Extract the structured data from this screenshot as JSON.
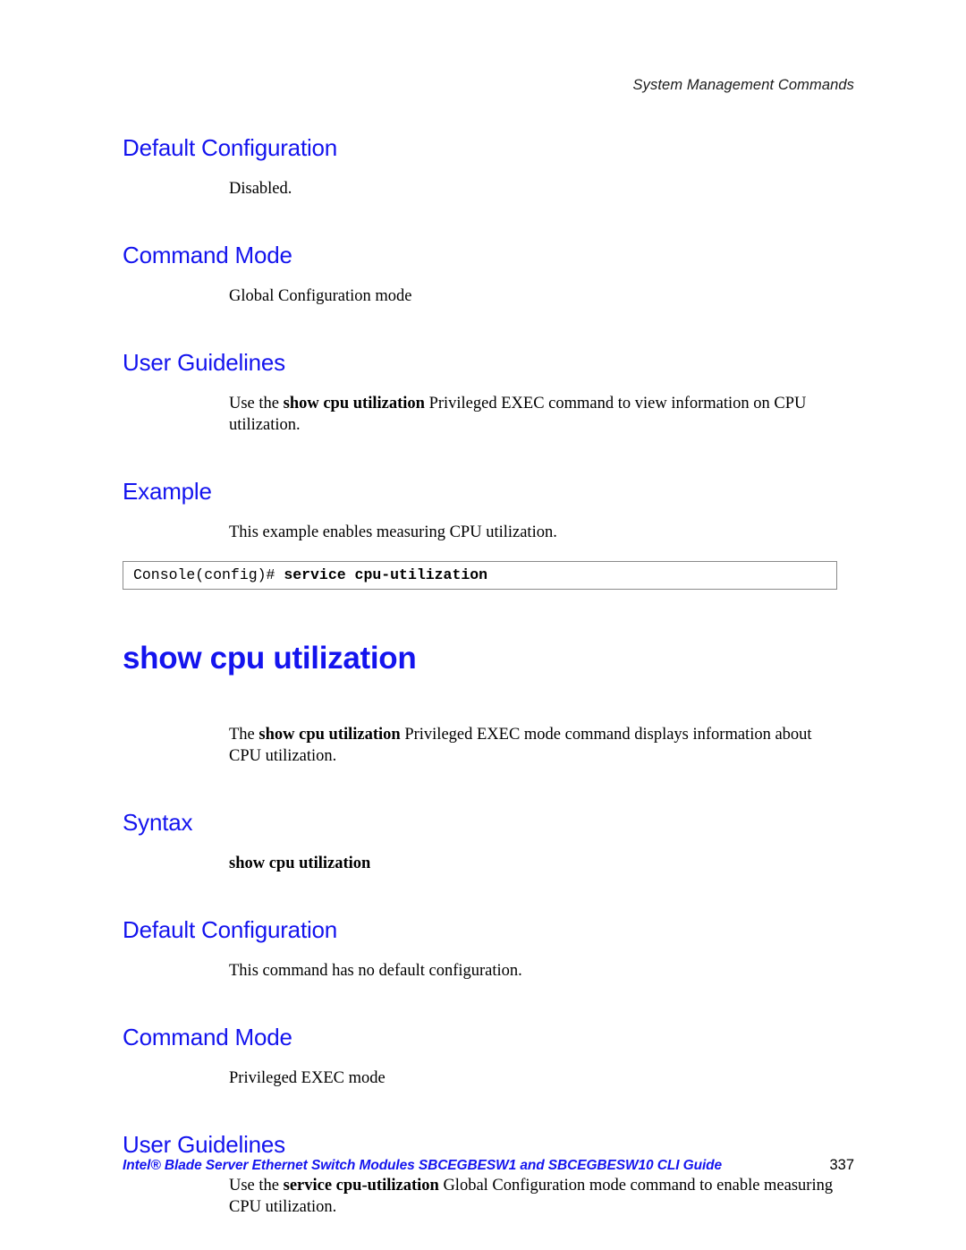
{
  "page": {
    "running_header": "System Management Commands",
    "number": "337",
    "footer_guide": "Intel® Blade Server Ethernet Switch Modules SBCEGBESW1 and SBCEGBESW10 CLI Guide",
    "heading_color": "#1414ee",
    "console_border_color": "#8a8a8a",
    "background_color": "#ffffff"
  },
  "sections": {
    "default_configuration_1": {
      "heading": "Default Configuration",
      "body": "Disabled."
    },
    "command_mode_1": {
      "heading": "Command Mode",
      "body": "Global Configuration mode"
    },
    "user_guidelines_1": {
      "heading": "User Guidelines",
      "body_prefix": "Use the ",
      "body_bold": "show cpu utilization",
      "body_suffix": " Privileged EXEC command to view information on CPU utilization."
    },
    "example_1": {
      "heading": "Example",
      "body": "This example enables measuring CPU utilization.",
      "console_prompt": "Console(config)# ",
      "console_command": "service cpu-utilization"
    },
    "command_title": {
      "title": "show cpu utilization",
      "description_prefix": "The ",
      "description_bold": "show cpu utilization",
      "description_suffix": " Privileged EXEC mode command displays information about CPU utilization."
    },
    "syntax": {
      "heading": "Syntax",
      "body": "show cpu utilization"
    },
    "default_configuration_2": {
      "heading": "Default Configuration",
      "body": "This command has no default configuration."
    },
    "command_mode_2": {
      "heading": "Command Mode",
      "body": "Privileged EXEC mode"
    },
    "user_guidelines_2": {
      "heading": "User Guidelines",
      "body_prefix": "Use the ",
      "body_bold": "service cpu-utilization",
      "body_suffix": " Global Configuration mode command to enable measuring CPU utilization."
    }
  }
}
